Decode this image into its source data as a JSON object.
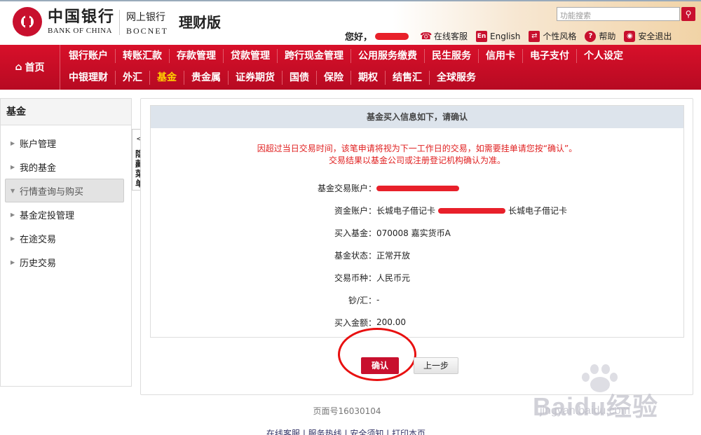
{
  "brand": {
    "cn_name": "中国银行",
    "en_name": "BANK OF CHINA",
    "product_cn": "网上银行",
    "product_en": "BOCNET",
    "edition": "理财版"
  },
  "header": {
    "search_placeholder": "功能搜索",
    "greeting": "您好，",
    "links": [
      {
        "label": "在线客服",
        "icon": "customer-service-icon"
      },
      {
        "label": "English",
        "icon": "english-icon"
      },
      {
        "label": "个性风格",
        "icon": "style-icon"
      },
      {
        "label": "帮助",
        "icon": "help-icon"
      },
      {
        "label": "安全退出",
        "icon": "lock-icon"
      }
    ]
  },
  "nav": {
    "home": "首页",
    "row1": [
      "银行账户",
      "转账汇款",
      "存款管理",
      "贷款管理",
      "跨行现金管理",
      "公用服务缴费",
      "民生服务",
      "信用卡",
      "电子支付",
      "个人设定"
    ],
    "row2": [
      "中银理财",
      "外汇",
      "基金",
      "贵金属",
      "证券期货",
      "国债",
      "保险",
      "期权",
      "结售汇",
      "全球服务"
    ],
    "active": "基金"
  },
  "sidebar": {
    "title": "基金",
    "items": [
      {
        "label": "账户管理",
        "expanded": false
      },
      {
        "label": "我的基金",
        "expanded": false
      },
      {
        "label": "行情查询与购买",
        "expanded": true
      },
      {
        "label": "基金定投管理",
        "expanded": false
      },
      {
        "label": "在途交易",
        "expanded": false
      },
      {
        "label": "历史交易",
        "expanded": false
      }
    ],
    "hide_label": "隐藏菜单"
  },
  "confirm": {
    "heading": "基金买入信息如下，请确认",
    "notice_line1": "因超过当日交易时间，该笔申请将视为下一工作日的交易，如需要挂单请您按“确认”。",
    "notice_line2": "交易结果以基金公司或注册登记机构确认为准。",
    "rows": [
      {
        "label": "基金交易账户",
        "value": ""
      },
      {
        "label": "资金账户",
        "value_prefix": "长城电子借记卡",
        "value_suffix": "长城电子借记卡"
      },
      {
        "label": "买入基金",
        "value": "070008 嘉实货币A"
      },
      {
        "label": "基金状态",
        "value": "正常开放"
      },
      {
        "label": "交易币种",
        "value": "人民币元"
      },
      {
        "label": "钞/汇",
        "value": "-"
      },
      {
        "label": "买入金额",
        "value": "200.00"
      }
    ],
    "confirm_button": "确认",
    "back_button": "上一步"
  },
  "footer": {
    "page_number": "页面号16030104",
    "link_text": "在线客服 | 服务热线 | 安全须知 | 打印本页"
  },
  "watermark": {
    "text": "Baidu经验",
    "url": "jingyan.baidu.com"
  }
}
